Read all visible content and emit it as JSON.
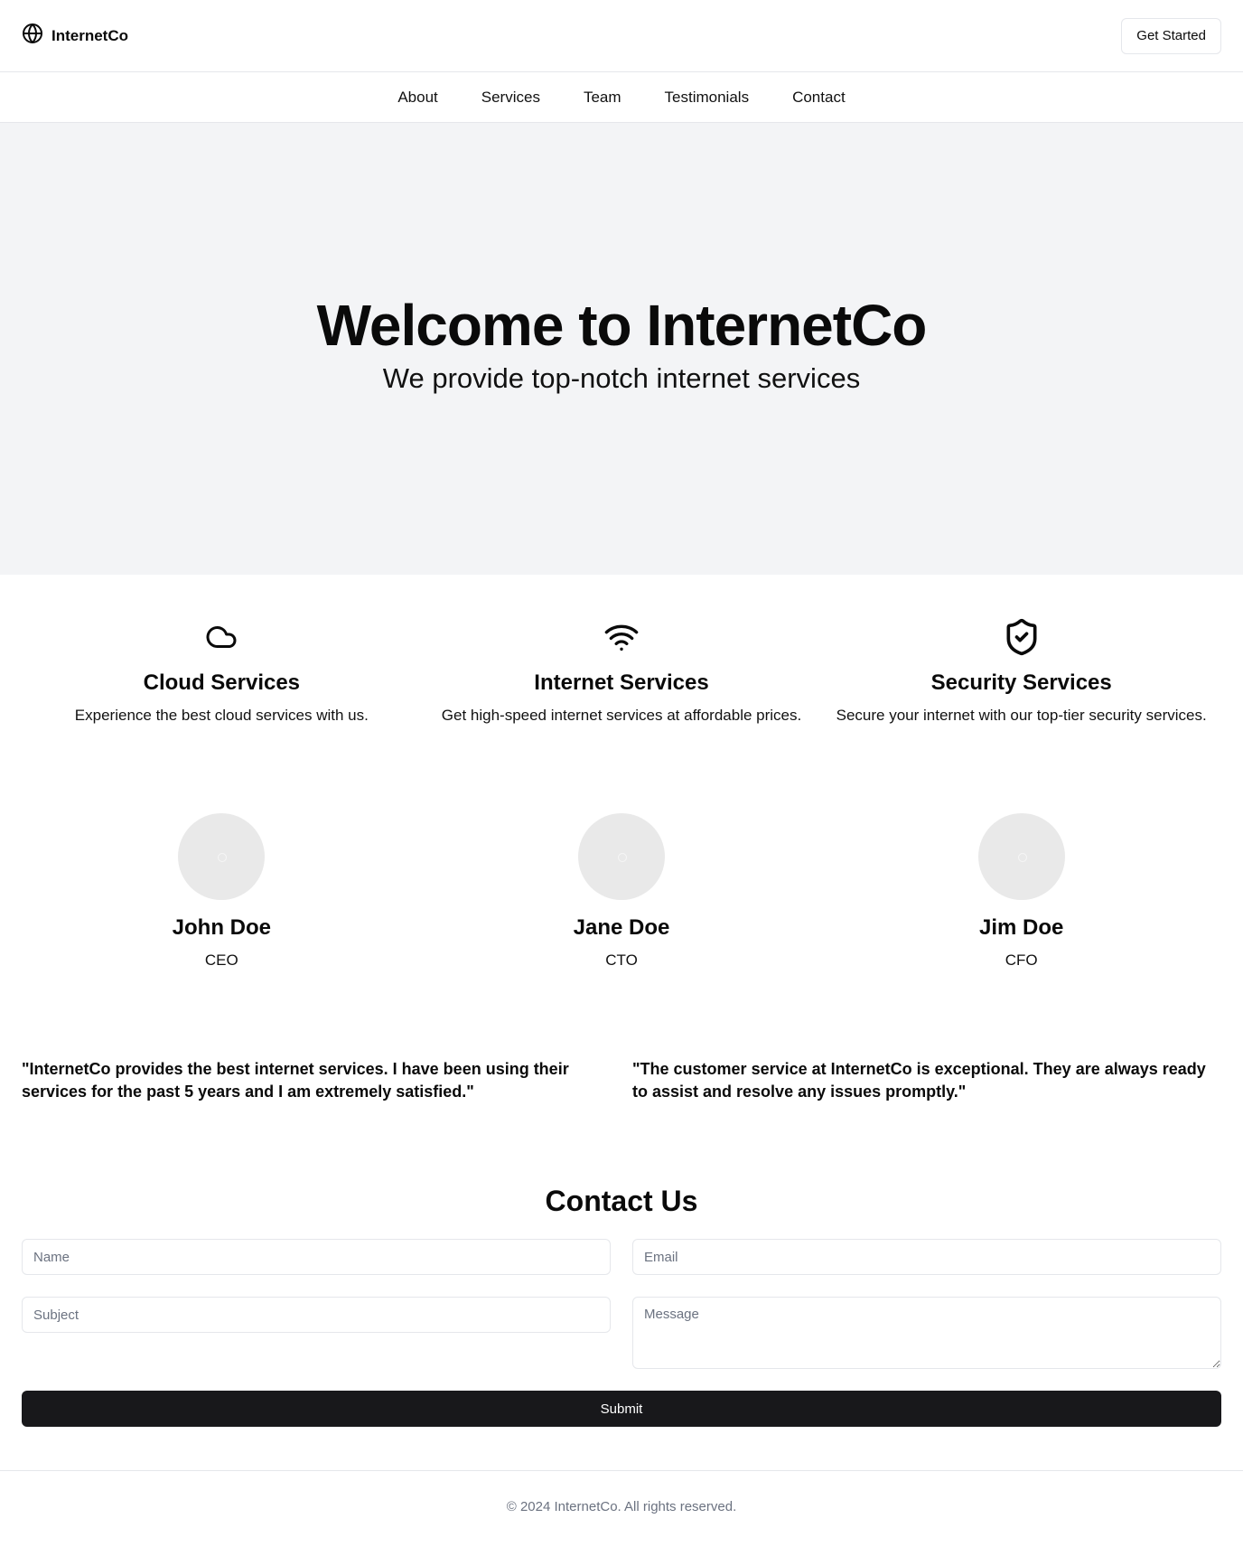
{
  "header": {
    "brand_icon": "globe-icon",
    "brand_name": "InternetCo",
    "cta_label": "Get Started"
  },
  "nav": {
    "items": [
      "About",
      "Services",
      "Team",
      "Testimonials",
      "Contact"
    ]
  },
  "hero": {
    "title": "Welcome to InternetCo",
    "subtitle": "We provide top-notch internet services"
  },
  "services": [
    {
      "icon": "cloud-icon",
      "title": "Cloud Services",
      "description": "Experience the best cloud services with us."
    },
    {
      "icon": "wifi-icon",
      "title": "Internet Services",
      "description": "Get high-speed internet services at affordable prices."
    },
    {
      "icon": "shield-check-icon",
      "title": "Security Services",
      "description": "Secure your internet with our top-tier security services."
    }
  ],
  "team": [
    {
      "name": "John Doe",
      "role": "CEO"
    },
    {
      "name": "Jane Doe",
      "role": "CTO"
    },
    {
      "name": "Jim Doe",
      "role": "CFO"
    }
  ],
  "testimonials": [
    "\"InternetCo provides the best internet services. I have been using their services for the past 5 years and I am extremely satisfied.\"",
    "\"The customer service at InternetCo is exceptional. They are always ready to assist and resolve any issues promptly.\""
  ],
  "contact": {
    "title": "Contact Us",
    "name_placeholder": "Name",
    "email_placeholder": "Email",
    "subject_placeholder": "Subject",
    "message_placeholder": "Message",
    "submit_label": "Submit"
  },
  "footer": {
    "copyright": "© 2024 InternetCo. All rights reserved."
  },
  "colors": {
    "hero_background": "#f3f4f6",
    "submit_background": "#18181b",
    "avatar_placeholder": "#e9e9e9"
  }
}
